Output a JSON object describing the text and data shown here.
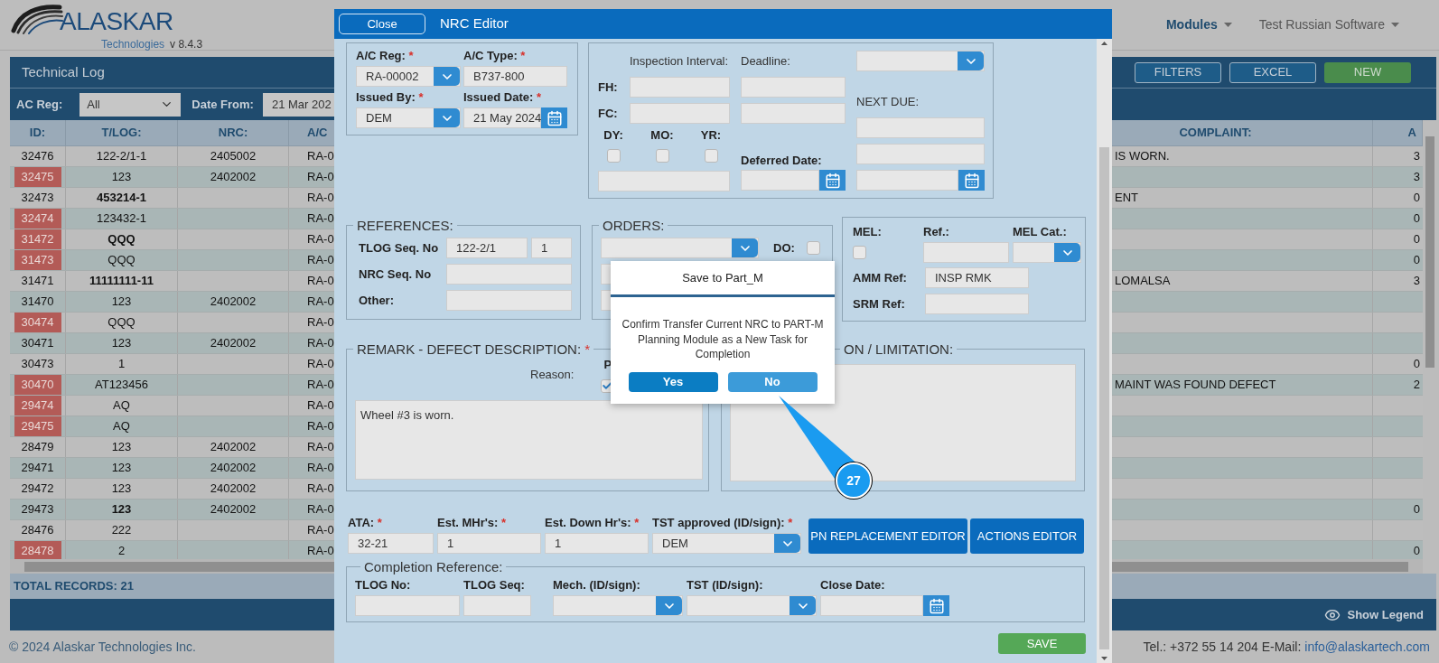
{
  "header": {
    "logo_text": "ALASKAR",
    "logo_subtitle": "Technologies",
    "version": "v 8.4.3",
    "nav": [
      {
        "label": "Modules",
        "selected": true
      },
      {
        "label": "Test Russian Software",
        "selected": false
      }
    ]
  },
  "technical_log": {
    "title": "Technical Log",
    "buttons": [
      {
        "label": "FILTERS",
        "kind": "outline"
      },
      {
        "label": "EXCEL",
        "kind": "outline"
      },
      {
        "label": "NEW",
        "kind": "primary"
      }
    ],
    "filters": [
      {
        "label": "AC Reg:",
        "value": "All",
        "kind": "select"
      },
      {
        "label": "Date From:",
        "value": "21 Mar 202",
        "kind": "date"
      }
    ],
    "table": {
      "columns": [
        "ID:",
        "T/LOG:",
        "NRC:",
        "A/C",
        "COMPLAINT:",
        "A"
      ],
      "rows": [
        {
          "id": "32476",
          "flagged": false,
          "tlog": "122-2/1-1",
          "tlog_bold": false,
          "nrc": "2405002",
          "ac": "RA-0",
          "complaint": "IS WORN.",
          "column_6": "3"
        },
        {
          "id": "32475",
          "flagged": true,
          "tlog": "123",
          "tlog_bold": false,
          "nrc": "2402002",
          "ac": "RA-0",
          "column_6": "3"
        },
        {
          "id": "32473",
          "flagged": false,
          "tlog": "453214-1",
          "tlog_bold": true,
          "ac": "RA-0",
          "complaint": "ENT",
          "column_6": "0"
        },
        {
          "id": "32474",
          "flagged": true,
          "tlog": "123432-1",
          "tlog_bold": false,
          "ac": "RA-0",
          "column_6": "0"
        },
        {
          "id": "31472",
          "flagged": true,
          "tlog": "QQQ",
          "tlog_bold": true,
          "ac": "RA-0",
          "column_6": "0"
        },
        {
          "id": "31473",
          "flagged": true,
          "tlog": "QQQ",
          "tlog_bold": false,
          "ac": "RA-0",
          "column_6": "0"
        },
        {
          "id": "31471",
          "flagged": false,
          "tlog": "11111111-11",
          "tlog_bold": true,
          "ac": "RA-0",
          "complaint": "LOMALSA",
          "column_6": "3"
        },
        {
          "id": "31470",
          "flagged": false,
          "tlog": "123",
          "tlog_bold": false,
          "nrc": "2402002",
          "ac": "RA-0"
        },
        {
          "id": "30474",
          "flagged": true,
          "tlog": "QQQ",
          "tlog_bold": false,
          "ac": "RA-0"
        },
        {
          "id": "30471",
          "flagged": false,
          "tlog": "123",
          "tlog_bold": false,
          "nrc": "2402002",
          "ac": "RA-0"
        },
        {
          "id": "30473",
          "flagged": false,
          "tlog": "1",
          "tlog_bold": false,
          "ac": "RA-0",
          "column_6": "0"
        },
        {
          "id": "30470",
          "flagged": true,
          "tlog": "AT123456",
          "tlog_bold": false,
          "ac": "RA-0",
          "complaint": "MAINT WAS FOUND DEFECT",
          "column_6": "2"
        },
        {
          "id": "29474",
          "flagged": true,
          "tlog": "AQ",
          "tlog_bold": false,
          "ac": "RA-0"
        },
        {
          "id": "29475",
          "flagged": true,
          "tlog": "AQ",
          "tlog_bold": false,
          "ac": "RA-0"
        },
        {
          "id": "28479",
          "flagged": false,
          "tlog": "123",
          "tlog_bold": false,
          "nrc": "2402002",
          "ac": "RA-0"
        },
        {
          "id": "29471",
          "flagged": false,
          "tlog": "123",
          "tlog_bold": false,
          "nrc": "2402002",
          "ac": "RA-0"
        },
        {
          "id": "29472",
          "flagged": false,
          "tlog": "123",
          "tlog_bold": false,
          "nrc": "2402002",
          "ac": "RA-0"
        },
        {
          "id": "29473",
          "flagged": false,
          "tlog": "123",
          "tlog_bold": true,
          "nrc": "2402002",
          "ac": "RA-0",
          "column_6": "0"
        },
        {
          "id": "28476",
          "flagged": false,
          "tlog": "222",
          "tlog_bold": false,
          "ac": "RA-0"
        },
        {
          "id": "28478",
          "flagged": true,
          "tlog": "2",
          "tlog_bold": false,
          "ac": "RA-0",
          "column_6": "0"
        }
      ]
    },
    "total_records": "TOTAL RECORDS: 21",
    "show_legend": "Show Legend"
  },
  "footer": {
    "copyright": "© 2024 Alaskar Technologies Inc.",
    "contact": "Tel.: +372 55 14 204 E-Mail:",
    "email": "info@alaskartech.com"
  },
  "nrc_editor": {
    "close_button": "Close",
    "title": "NRC Editor",
    "aircraft": [
      {
        "label": "A/C Reg:",
        "mark": "*",
        "value": "RA-00002",
        "kind": "select"
      },
      {
        "label": "A/C Type:",
        "mark": "*",
        "value": "B737-800",
        "kind": "text"
      },
      {
        "label": "Issued By:",
        "mark": "*",
        "value": "DEM",
        "kind": "select"
      },
      {
        "label": "Issued Date:",
        "mark": "*",
        "value": "21 May 2024",
        "kind": "date"
      }
    ],
    "interval": {
      "inspection_interval": "Inspection Interval:",
      "deadline": "Deadline:",
      "rows": [
        {
          "label": "FH:"
        },
        {
          "label": "FC:"
        }
      ],
      "periods": [
        {
          "label": "DY:",
          "checked": false
        },
        {
          "label": "MO:",
          "checked": false
        },
        {
          "label": "YR:",
          "checked": false
        }
      ],
      "deferred_date": "Deferred Date:",
      "next_due": "NEXT DUE:"
    },
    "references": {
      "legend": "REFERENCES:",
      "rows": [
        {
          "label": "TLOG Seq. No",
          "kind": "pair",
          "value": "122-2/1",
          "value_2": "1"
        },
        {
          "label": "NRC Seq. No",
          "kind": "single"
        },
        {
          "label": "Other:",
          "kind": "single"
        }
      ]
    },
    "orders": {
      "legend": "ORDERS:",
      "do_label": "DO:",
      "do_checked": false
    },
    "mel": {
      "label": "MEL:",
      "checked": false,
      "ref_label": "Ref.:",
      "cat_label": "MEL Cat.:",
      "amm_label": "AMM Ref:",
      "amm_value": "INSP RMK",
      "srm_label": "SRM Ref:"
    },
    "remark": {
      "legend": "REMARK - DEFECT DESCRIPTION:",
      "mark": "*",
      "reason_label": "Reason:",
      "reason_option": {
        "label": "P",
        "checked": true
      },
      "text": "Wheel #3 is worn."
    },
    "limitation": {
      "legend": "ON / LIMITATION:"
    },
    "task": [
      {
        "label": "ATA:",
        "mark": "*",
        "value": "32-21",
        "kind": "text"
      },
      {
        "label": "Est. MHr's:",
        "mark": "*",
        "value": "1",
        "kind": "text"
      },
      {
        "label": "Est. Down Hr's:",
        "mark": "*",
        "value": "1",
        "kind": "text"
      },
      {
        "label": "TST approved (ID/sign):",
        "mark": "*",
        "value": "DEM",
        "kind": "select"
      }
    ],
    "editor_buttons": [
      "PN REPLACEMENT EDITOR",
      "ACTIONS EDITOR"
    ],
    "completion": {
      "legend": "Completion Reference:",
      "fields": [
        {
          "label": "TLOG No:",
          "kind": "text"
        },
        {
          "label": "TLOG Seq:",
          "kind": "text"
        },
        {
          "label": "Mech. (ID/sign):",
          "kind": "select"
        },
        {
          "label": "TST (ID/sign):",
          "kind": "select"
        },
        {
          "label": "Close Date:",
          "kind": "date"
        }
      ]
    },
    "save_button": "SAVE"
  },
  "confirm_dialog": {
    "title": "Save to Part_M",
    "message": "Confirm Transfer Current NRC to PART-M Planning Module as a New Task for Completion",
    "buttons": [
      {
        "label": "Yes",
        "kind": "primary"
      },
      {
        "label": "No",
        "kind": "secondary"
      }
    ]
  },
  "callout": {
    "number": "27"
  }
}
